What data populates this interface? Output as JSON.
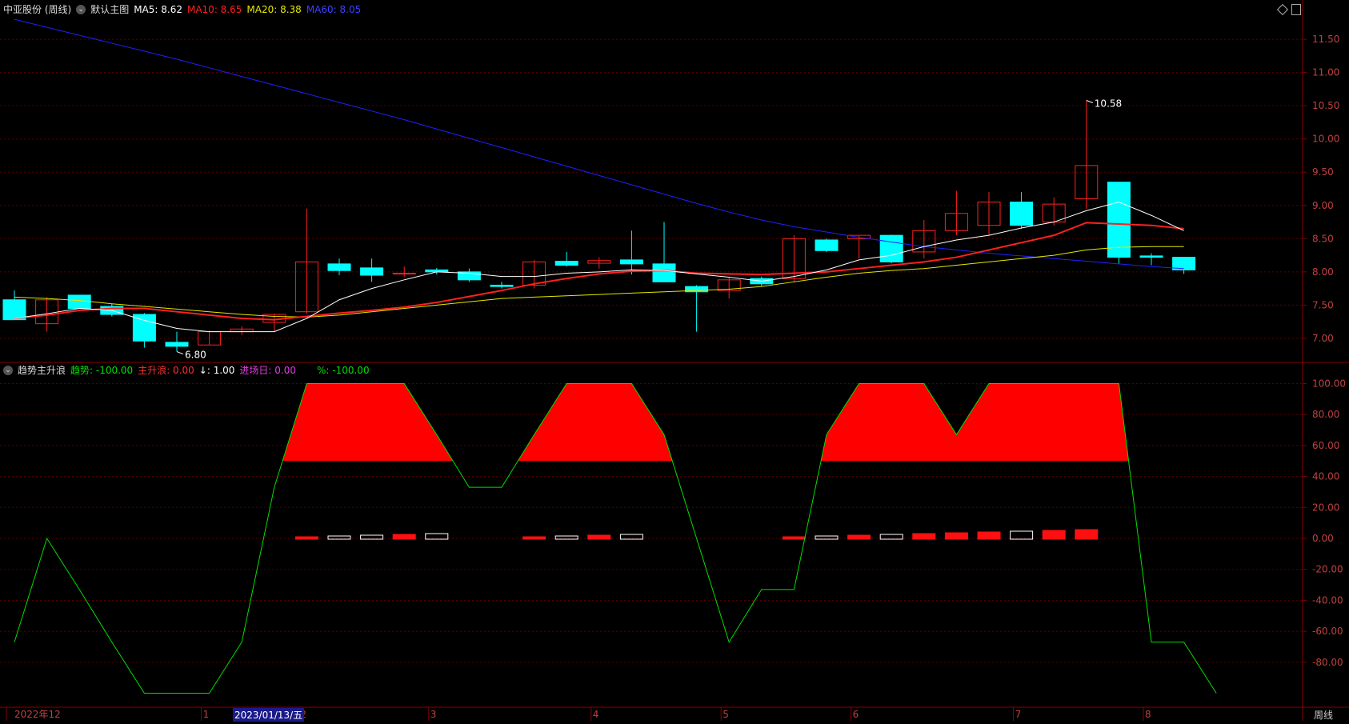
{
  "header": {
    "stock_name": "中亚股份 (周线)",
    "template_label": "默认主图",
    "ma5_label": "MA5: 8.62",
    "ma10_label": "MA10: 8.65",
    "ma20_label": "MA20: 8.38",
    "ma60_label": "MA60: 8.05"
  },
  "indicator_header": {
    "name": "趋势主升浪",
    "trend_label": "趋势: -100.00",
    "main_wave_label": "主升浪: 0.00",
    "down_label": "↓: 1.00",
    "entry_label": "进场日: 0.00",
    "percent_label": "%: -100.00"
  },
  "footer": {
    "period_label": "周线",
    "current_date_label": "2023/01/13/五",
    "first_label": "2022年12"
  },
  "colors": {
    "up": "#ff2020",
    "down": "#00ffff",
    "ma5": "#ffffff",
    "ma10": "#ff2020",
    "ma20": "#e6e600",
    "ma60": "#2020ff",
    "trend": "#00e000",
    "grid": "#5a0000",
    "axis_text": "#c04040"
  },
  "chart_data": [
    {
      "type": "candlestick",
      "title": "中亚股份 (周线)",
      "price_axis": [
        "11.50",
        "11.00",
        "10.50",
        "10.00",
        "9.50",
        "9.00",
        "8.50",
        "8.00",
        "7.50",
        "7.00"
      ],
      "ylim": [
        6.65,
        11.85
      ],
      "grid": true,
      "x_axis_labels": [
        {
          "index": 0,
          "text": "2022年12"
        },
        {
          "index": 6,
          "text": "1"
        },
        {
          "index": 9,
          "text": "2"
        },
        {
          "index": 13,
          "text": "3"
        },
        {
          "index": 18,
          "text": "4"
        },
        {
          "index": 22,
          "text": "5"
        },
        {
          "index": 26,
          "text": "6"
        },
        {
          "index": 31,
          "text": "7"
        },
        {
          "index": 35,
          "text": "8"
        }
      ],
      "candles": [
        {
          "o": 7.58,
          "h": 7.72,
          "l": 7.28,
          "c": 7.28
        },
        {
          "o": 7.22,
          "h": 7.62,
          "l": 7.1,
          "c": 7.58
        },
        {
          "o": 7.65,
          "h": 7.65,
          "l": 7.45,
          "c": 7.45
        },
        {
          "o": 7.48,
          "h": 7.52,
          "l": 7.33,
          "c": 7.36
        },
        {
          "o": 7.36,
          "h": 7.38,
          "l": 6.86,
          "c": 6.96
        },
        {
          "o": 6.94,
          "h": 7.1,
          "l": 6.8,
          "c": 6.88
        },
        {
          "o": 6.9,
          "h": 7.12,
          "l": 6.9,
          "c": 7.1
        },
        {
          "o": 7.1,
          "h": 7.18,
          "l": 7.05,
          "c": 7.14
        },
        {
          "o": 7.24,
          "h": 7.37,
          "l": 7.1,
          "c": 7.36
        },
        {
          "o": 7.4,
          "h": 8.95,
          "l": 7.37,
          "c": 8.15
        },
        {
          "o": 8.12,
          "h": 8.2,
          "l": 7.95,
          "c": 8.02
        },
        {
          "o": 8.06,
          "h": 8.2,
          "l": 7.85,
          "c": 7.95
        },
        {
          "o": 7.98,
          "h": 8.08,
          "l": 7.92,
          "c": 7.98
        },
        {
          "o": 8.03,
          "h": 8.06,
          "l": 7.96,
          "c": 8.0
        },
        {
          "o": 8.0,
          "h": 8.05,
          "l": 7.85,
          "c": 7.88
        },
        {
          "o": 7.8,
          "h": 7.85,
          "l": 7.75,
          "c": 7.78
        },
        {
          "o": 7.8,
          "h": 8.18,
          "l": 7.75,
          "c": 8.15
        },
        {
          "o": 8.16,
          "h": 8.3,
          "l": 8.08,
          "c": 8.1
        },
        {
          "o": 8.13,
          "h": 8.22,
          "l": 8.05,
          "c": 8.17
        },
        {
          "o": 8.18,
          "h": 8.62,
          "l": 7.96,
          "c": 8.12
        },
        {
          "o": 8.12,
          "h": 8.75,
          "l": 7.95,
          "c": 7.85
        },
        {
          "o": 7.78,
          "h": 7.8,
          "l": 7.1,
          "c": 7.7
        },
        {
          "o": 7.72,
          "h": 7.92,
          "l": 7.6,
          "c": 7.88
        },
        {
          "o": 7.9,
          "h": 7.93,
          "l": 7.78,
          "c": 7.82
        },
        {
          "o": 7.9,
          "h": 8.55,
          "l": 7.84,
          "c": 8.5
        },
        {
          "o": 8.48,
          "h": 8.5,
          "l": 8.3,
          "c": 8.32
        },
        {
          "o": 8.5,
          "h": 8.55,
          "l": 8.2,
          "c": 8.55
        },
        {
          "o": 8.55,
          "h": 8.56,
          "l": 8.13,
          "c": 8.15
        },
        {
          "o": 8.3,
          "h": 8.78,
          "l": 8.2,
          "c": 8.62
        },
        {
          "o": 8.62,
          "h": 9.22,
          "l": 8.55,
          "c": 8.88
        },
        {
          "o": 8.7,
          "h": 9.2,
          "l": 8.55,
          "c": 9.05
        },
        {
          "o": 9.05,
          "h": 9.2,
          "l": 8.65,
          "c": 8.7
        },
        {
          "o": 8.75,
          "h": 9.12,
          "l": 8.7,
          "c": 9.02
        },
        {
          "o": 9.1,
          "h": 10.58,
          "l": 8.95,
          "c": 9.6
        },
        {
          "o": 9.35,
          "h": 9.35,
          "l": 8.12,
          "c": 8.22
        },
        {
          "o": 8.24,
          "h": 8.28,
          "l": 8.1,
          "c": 8.22
        },
        {
          "o": 8.22,
          "h": 8.22,
          "l": 7.97,
          "c": 8.03
        }
      ],
      "ma5": [
        7.3,
        7.37,
        7.45,
        7.42,
        7.27,
        7.15,
        7.1,
        7.1,
        7.1,
        7.3,
        7.58,
        7.75,
        7.88,
        8.0,
        7.98,
        7.93,
        7.93,
        7.98,
        8.0,
        8.03,
        8.02,
        7.97,
        7.92,
        7.86,
        7.93,
        8.03,
        8.18,
        8.25,
        8.38,
        8.48,
        8.55,
        8.66,
        8.75,
        8.92,
        9.05,
        8.85,
        8.62
      ],
      "ma10": [
        7.3,
        7.35,
        7.42,
        7.45,
        7.45,
        7.4,
        7.35,
        7.3,
        7.28,
        7.33,
        7.38,
        7.42,
        7.47,
        7.54,
        7.63,
        7.72,
        7.82,
        7.9,
        7.97,
        8.01,
        8.02,
        7.98,
        7.97,
        7.96,
        7.98,
        8.0,
        8.05,
        8.1,
        8.15,
        8.22,
        8.33,
        8.44,
        8.55,
        8.74,
        8.72,
        8.7,
        8.65
      ],
      "ma20": [
        7.62,
        7.6,
        7.57,
        7.52,
        7.48,
        7.44,
        7.4,
        7.36,
        7.33,
        7.32,
        7.35,
        7.4,
        7.45,
        7.5,
        7.55,
        7.6,
        7.62,
        7.64,
        7.66,
        7.68,
        7.7,
        7.72,
        7.74,
        7.78,
        7.85,
        7.92,
        7.98,
        8.02,
        8.05,
        8.1,
        8.15,
        8.2,
        8.25,
        8.33,
        8.37,
        8.38,
        8.38
      ],
      "ma60": [
        11.8,
        11.68,
        11.56,
        11.44,
        11.32,
        11.2,
        11.07,
        10.94,
        10.81,
        10.68,
        10.55,
        10.42,
        10.29,
        10.15,
        10.01,
        9.87,
        9.73,
        9.59,
        9.45,
        9.31,
        9.17,
        9.03,
        8.9,
        8.78,
        8.68,
        8.6,
        8.52,
        8.45,
        8.38,
        8.33,
        8.28,
        8.24,
        8.2,
        8.16,
        8.12,
        8.08,
        8.05
      ],
      "annotations": [
        {
          "text": "10.58",
          "index": 33,
          "value": 10.58
        },
        {
          "text": "6.80",
          "index": 5,
          "value": 6.8
        }
      ]
    },
    {
      "type": "line",
      "title": "趋势主升浪",
      "value_axis": [
        "100.00",
        "80.00",
        "60.00",
        "40.00",
        "20.00",
        "0.00",
        "-20.00",
        "-40.00",
        "-60.00",
        "-80.00"
      ],
      "ylim": [
        -107,
        107
      ],
      "grid": true,
      "series": [
        {
          "name": "趋势",
          "values": [
            -67,
            0,
            -33,
            -67,
            -100,
            -100,
            -100,
            -67,
            33,
            100,
            100,
            100,
            100,
            67,
            33,
            33,
            67,
            100,
            100,
            100,
            67,
            0,
            -67,
            -33,
            -33,
            67,
            100,
            100,
            100,
            67,
            100,
            100,
            100,
            100,
            100,
            -67,
            -67,
            -100
          ]
        },
        {
          "name": "主升浪",
          "values": [
            0,
            0,
            0,
            0,
            0,
            0,
            0,
            0,
            0,
            0,
            0,
            0,
            0,
            0,
            0,
            0,
            0,
            0,
            0,
            0,
            0,
            0,
            0,
            0,
            0,
            0,
            0,
            0,
            0,
            0,
            0,
            0,
            0,
            0,
            0,
            0,
            0,
            0
          ]
        }
      ],
      "fill_threshold": 50,
      "bars": [
        {
          "index": 9,
          "value": 1,
          "hollow": false
        },
        {
          "index": 10,
          "value": 2,
          "hollow": true
        },
        {
          "index": 11,
          "value": 3,
          "hollow": true
        },
        {
          "index": 12,
          "value": 4,
          "hollow": false
        },
        {
          "index": 13,
          "value": 5,
          "hollow": true
        },
        {
          "index": 16,
          "value": 1,
          "hollow": false
        },
        {
          "index": 17,
          "value": 2,
          "hollow": true
        },
        {
          "index": 18,
          "value": 3,
          "hollow": false
        },
        {
          "index": 19,
          "value": 4,
          "hollow": true
        },
        {
          "index": 24,
          "value": 1,
          "hollow": false
        },
        {
          "index": 25,
          "value": 2,
          "hollow": true
        },
        {
          "index": 26,
          "value": 3,
          "hollow": false
        },
        {
          "index": 27,
          "value": 4,
          "hollow": true
        },
        {
          "index": 28,
          "value": 5,
          "hollow": false
        },
        {
          "index": 29,
          "value": 6,
          "hollow": false
        },
        {
          "index": 30,
          "value": 7,
          "hollow": false
        },
        {
          "index": 31,
          "value": 8,
          "hollow": true
        },
        {
          "index": 32,
          "value": 9,
          "hollow": false
        },
        {
          "index": 33,
          "value": 10,
          "hollow": false
        }
      ]
    }
  ]
}
